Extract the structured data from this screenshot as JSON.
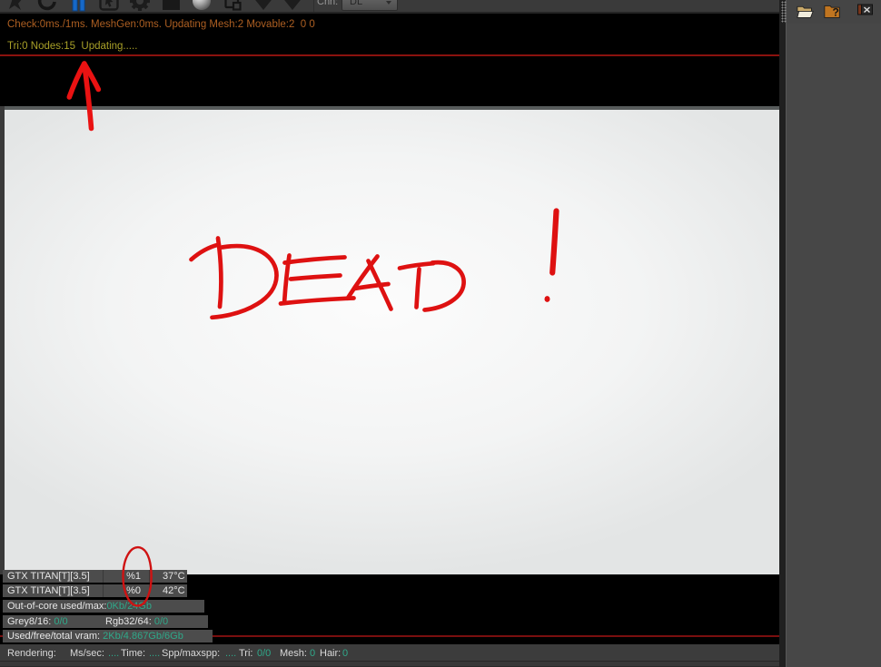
{
  "toolbar": {
    "icon_names": [
      "pin-icon",
      "refresh-icon",
      "pause-icon",
      "select-region-icon",
      "gear-icon",
      "film-square-icon",
      "sphere-icon",
      "copy-page-icon",
      "pick-down-icon",
      "pick-down-icon-2"
    ],
    "channel_label": "Chn:",
    "channel_value": "DL"
  },
  "top_status": {
    "line1": "Check:0ms./1ms. MeshGen:0ms. Updating Mesh:2 Movable:2  0 0",
    "line2": "Tri:0 Nodes:15  Updating....."
  },
  "viewport": {
    "drawing_text": "DEAD !"
  },
  "gpu_panel": {
    "rows": [
      {
        "name": "GTX TITAN[T][3.5]",
        "load": "%1",
        "temp": "37°C"
      },
      {
        "name": "GTX TITAN[T][3.5]",
        "load": "%0",
        "temp": "42°C"
      }
    ],
    "out_of_core_label": "Out-of-core used/max:",
    "out_of_core_value": "0Kb/24Gb",
    "grey_label": "Grey8/16:",
    "grey_value": "0/0",
    "rgb_label": "Rgb32/64:",
    "rgb_value": "0/0",
    "vram_label": "Used/free/total vram:",
    "vram_value": "2Kb/4.867Gb/6Gb"
  },
  "statusbar": {
    "rendering_label": "Rendering:",
    "ms_label": "Ms/sec:",
    "ms_value": "....",
    "time_label": "Time:",
    "time_value": "....",
    "spp_label": "Spp/maxspp:",
    "spp_value": "....",
    "tri_label": "Tri:",
    "tri_value": "0/0",
    "mesh_label": "Mesh:",
    "mesh_value": "0",
    "hair_label": "Hair:",
    "hair_value": "0"
  },
  "colors": {
    "accent_teal": "#2fa98a",
    "status_orange": "#ad5f22",
    "status_yellow": "#a8a028",
    "annotation_red": "#e01212",
    "separator_red": "#8b120e"
  }
}
